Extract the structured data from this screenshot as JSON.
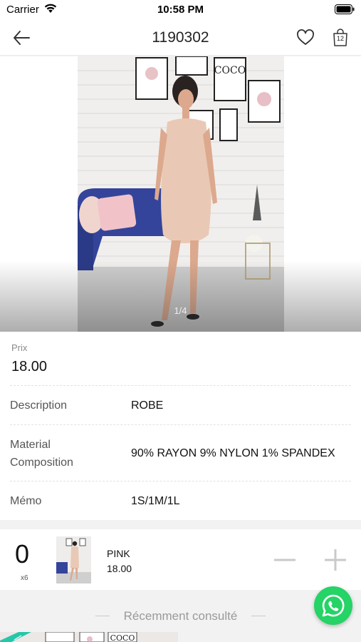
{
  "status_bar": {
    "carrier": "Carrier",
    "time": "10:58 PM"
  },
  "nav": {
    "title": "1190302",
    "cart_count": "12"
  },
  "gallery": {
    "counter": "1/4"
  },
  "price": {
    "label": "Prix",
    "value": "18.00"
  },
  "details": [
    {
      "label": "Description",
      "value": "ROBE"
    },
    {
      "label": "Material Composition",
      "value": "90% RAYON 9% NYLON 1% SPANDEX"
    },
    {
      "label": "Mémo",
      "value": "1S/1M/1L"
    }
  ],
  "cart_item": {
    "quantity": "0",
    "pack": "x6",
    "color": "PINK",
    "price": "18.00"
  },
  "recent": {
    "title": "Récemment consulté",
    "photo_sign_text": "COCO"
  },
  "colors": {
    "accent_green": "#25d366",
    "ribbon_teal": "#26c6a8",
    "dress": "#e9c9b5",
    "sofa": "#34449a"
  },
  "icons": [
    "back-arrow-icon",
    "heart-icon",
    "shopping-bag-icon",
    "minus-icon",
    "plus-icon",
    "whatsapp-icon",
    "wifi-icon",
    "battery-icon"
  ]
}
